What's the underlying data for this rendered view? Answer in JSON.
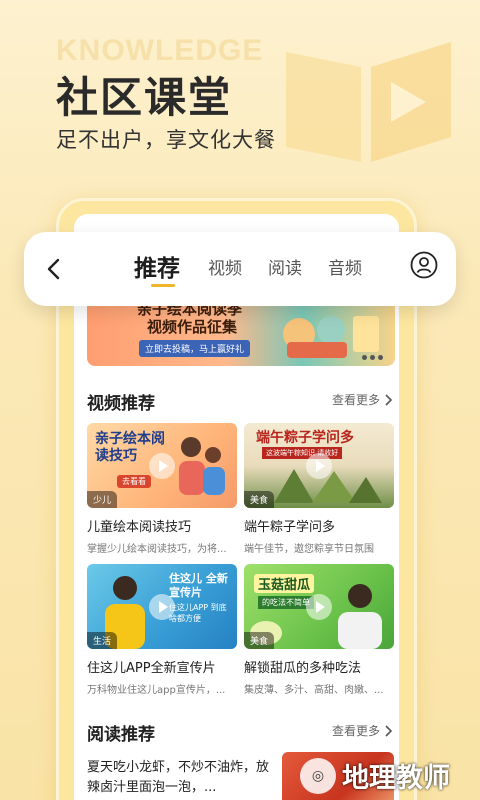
{
  "hero": {
    "bg_word": "KNOWLEDGE",
    "title": "社区课堂",
    "subtitle": "足不出户，享文化大餐"
  },
  "topbar": {
    "tabs": [
      {
        "label": "推荐",
        "active": true
      },
      {
        "label": "视频",
        "active": false
      },
      {
        "label": "阅读",
        "active": false
      },
      {
        "label": "音频",
        "active": false
      }
    ]
  },
  "banner": {
    "line1": "亲子绘本阅读季",
    "line2": "视频作品征集",
    "button": "立即去投稿，马上赢好礼"
  },
  "video_section": {
    "title": "视频推荐",
    "more": "查看更多",
    "cards": [
      {
        "thumb_title": "亲子绘本阅读技巧",
        "thumb_button": "去看看",
        "tag": "少儿",
        "title": "儿童绘本阅读技巧",
        "desc": "掌握少儿绘本阅读技巧，为将..."
      },
      {
        "thumb_title": "端午粽子学问多",
        "thumb_sub": "这波端午粽知识 请收好",
        "tag": "美食",
        "title": "端午粽子学问多",
        "desc": "端午佳节，遨您粽享节日氛围"
      },
      {
        "thumb_title": "住这儿 全新宣传片",
        "thumb_sub": "住这儿APP 到底啥都方便",
        "tag": "生活",
        "title": "住这儿APP全新宣传片",
        "desc": "万科物业住这儿app宣传片，..."
      },
      {
        "thumb_title": "玉菇甜瓜",
        "thumb_sub": "的吃法不简单",
        "tag": "美食",
        "title": "解锁甜瓜的多种吃法",
        "desc": "集皮薄、多汁、高甜、肉嫩、..."
      }
    ]
  },
  "reading_section": {
    "title": "阅读推荐",
    "more": "查看更多",
    "article": "夏天吃小龙虾，不炒不油炸，放辣卤汁里面泡一泡，..."
  },
  "watermark": {
    "text": "地理教师"
  },
  "colors": {
    "accent": "#f0b62a",
    "background": "#fbe9b8",
    "frame": "#fde7a0"
  }
}
